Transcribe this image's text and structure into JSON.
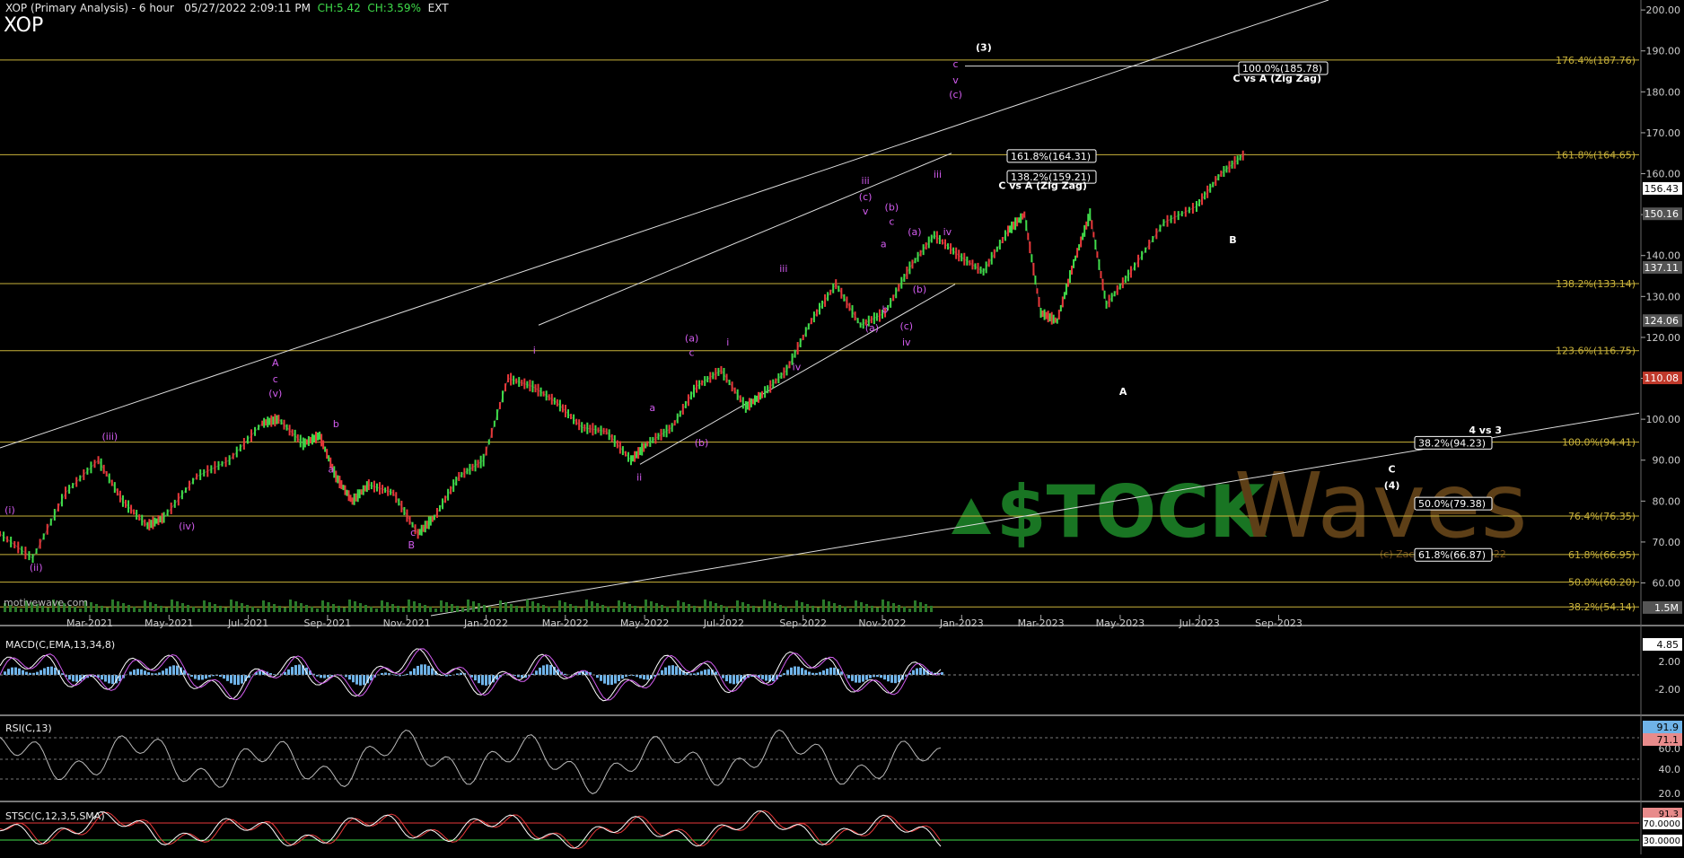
{
  "header": {
    "title": "XOP (Primary Analysis) - 6 hour",
    "datetime": "05/27/2022 2:09:11 PM",
    "ch": "CH:5.42",
    "chpct": "CH:3.59%",
    "ext": "EXT",
    "symbol": "XOP",
    "watermark": "motivewave.com"
  },
  "colors": {
    "fib": "#c9b23a",
    "wave": "#d35cf0",
    "up": "#3fdc4a",
    "down": "#e8383a",
    "white": "#ffffff",
    "logo_green": "#1e8a2a",
    "logo_brown": "#6e4a1c"
  },
  "chart_data": {
    "type": "line",
    "x_ticks": [
      "Mar-2021",
      "May-2021",
      "Jul-2021",
      "Sep-2021",
      "Nov-2021",
      "Jan-2022",
      "Mar-2022",
      "May-2022",
      "Jul-2022",
      "Sep-2022",
      "Nov-2022",
      "Jan-2023",
      "Mar-2023",
      "May-2023",
      "Jul-2023",
      "Sep-2023"
    ],
    "y_ticks": [
      200,
      190,
      180,
      170,
      160,
      150,
      140,
      130,
      120,
      110,
      100,
      90,
      80,
      70,
      60
    ],
    "ylim": [
      52,
      202
    ],
    "price_flags": [
      {
        "label": "156.43",
        "value": 156.4,
        "style": "white"
      },
      {
        "label": "150.16",
        "value": 150.2,
        "style": "gray"
      },
      {
        "label": "137.11",
        "value": 137.1,
        "style": "gray"
      },
      {
        "label": "124.06",
        "value": 124.1,
        "style": "gray"
      },
      {
        "label": "110.08",
        "value": 110.1,
        "style": "red"
      },
      {
        "label": "1.5M",
        "value": 54.0,
        "style": "gray"
      }
    ],
    "price_path": [
      [
        0,
        72
      ],
      [
        0.02,
        66
      ],
      [
        0.04,
        82
      ],
      [
        0.06,
        90
      ],
      [
        0.075,
        80
      ],
      [
        0.09,
        74
      ],
      [
        0.1,
        76
      ],
      [
        0.12,
        86
      ],
      [
        0.14,
        90
      ],
      [
        0.16,
        99
      ],
      [
        0.17,
        100
      ],
      [
        0.185,
        94
      ],
      [
        0.195,
        96
      ],
      [
        0.205,
        86
      ],
      [
        0.215,
        80
      ],
      [
        0.225,
        84
      ],
      [
        0.24,
        82
      ],
      [
        0.255,
        72
      ],
      [
        0.265,
        76
      ],
      [
        0.28,
        86
      ],
      [
        0.295,
        90
      ],
      [
        0.31,
        110
      ],
      [
        0.325,
        108
      ],
      [
        0.34,
        104
      ],
      [
        0.355,
        98
      ],
      [
        0.37,
        97
      ],
      [
        0.385,
        90
      ],
      [
        0.395,
        94
      ],
      [
        0.41,
        98
      ],
      [
        0.425,
        108
      ],
      [
        0.44,
        112
      ],
      [
        0.455,
        103
      ],
      [
        0.465,
        106
      ],
      [
        0.48,
        112
      ],
      [
        0.495,
        124
      ],
      [
        0.51,
        133
      ],
      [
        0.525,
        123
      ],
      [
        0.54,
        126
      ],
      [
        0.555,
        137
      ],
      [
        0.57,
        145
      ],
      [
        0.585,
        140
      ],
      [
        0.6,
        136
      ],
      [
        0.615,
        146
      ],
      [
        0.625,
        150
      ],
      [
        0.635,
        126
      ],
      [
        0.645,
        124
      ],
      [
        0.655,
        138
      ],
      [
        0.665,
        150
      ],
      [
        0.675,
        128
      ],
      [
        0.69,
        136
      ],
      [
        0.71,
        148
      ],
      [
        0.73,
        152
      ],
      [
        0.745,
        160
      ],
      [
        0.76,
        165
      ]
    ],
    "fib_levels": [
      {
        "label": "176.4%(187.76)",
        "value": 187.76
      },
      {
        "label": "161.8%(164.65)",
        "value": 164.65
      },
      {
        "label": "138.2%(133.14)",
        "value": 133.14
      },
      {
        "label": "123.6%(116.75)",
        "value": 116.75
      },
      {
        "label": "100.0%(94.41)",
        "value": 94.41
      },
      {
        "label": "76.4%(76.35)",
        "value": 76.35
      },
      {
        "label": "61.8%(66.95)",
        "value": 66.95
      },
      {
        "label": "50.0%(60.20)",
        "value": 60.2
      },
      {
        "label": "38.2%(54.14)",
        "value": 54.14
      }
    ],
    "target_boxes": [
      {
        "label": "100.0%(185.78)",
        "value": 185.78
      },
      {
        "label": "161.8%(164.31)",
        "value": 164.31
      },
      {
        "label": "138.2%(159.21)",
        "value": 159.21
      },
      {
        "label": "38.2%(94.23)",
        "value": 94.23
      },
      {
        "label": "50.0%(79.38)",
        "value": 79.38
      },
      {
        "label": "61.8%(66.87)",
        "value": 66.87
      }
    ],
    "annotations": [
      {
        "text": "C vs A (Zig Zag)",
        "value": 182.5,
        "xf": 0.76
      },
      {
        "text": "C vs A (Zig Zag)",
        "value": 156.3,
        "xf": 0.617
      },
      {
        "text": "4 vs 3",
        "value": 96.5,
        "xf": 0.887
      },
      {
        "text": "B",
        "value": 143,
        "xf": 0.733
      },
      {
        "text": "A",
        "value": 106,
        "xf": 0.666
      },
      {
        "text": "C",
        "value": 87,
        "xf": 0.83
      },
      {
        "text": "(4)",
        "value": 83,
        "xf": 0.83
      },
      {
        "text": "(3)",
        "value": 190,
        "xf": 0.581
      }
    ],
    "wave_labels": [
      {
        "text": "(i)",
        "value": 77,
        "xf": 0.006
      },
      {
        "text": "(ii)",
        "value": 63,
        "xf": 0.022
      },
      {
        "text": "(iii)",
        "value": 95,
        "xf": 0.067
      },
      {
        "text": "(iv)",
        "value": 73,
        "xf": 0.114
      },
      {
        "text": "A",
        "value": 113,
        "xf": 0.168
      },
      {
        "text": "c",
        "value": 109,
        "xf": 0.168
      },
      {
        "text": "(v)",
        "value": 105.5,
        "xf": 0.168
      },
      {
        "text": "b",
        "value": 98,
        "xf": 0.205
      },
      {
        "text": "a",
        "value": 87,
        "xf": 0.202
      },
      {
        "text": "c",
        "value": 71.5,
        "xf": 0.252
      },
      {
        "text": "B",
        "value": 68.5,
        "xf": 0.251
      },
      {
        "text": "i",
        "value": 116,
        "xf": 0.326
      },
      {
        "text": "ii",
        "value": 85,
        "xf": 0.39
      },
      {
        "text": "(a)",
        "value": 119,
        "xf": 0.422
      },
      {
        "text": "c",
        "value": 115.5,
        "xf": 0.422
      },
      {
        "text": "a",
        "value": 102,
        "xf": 0.398
      },
      {
        "text": "(b)",
        "value": 93.5,
        "xf": 0.428
      },
      {
        "text": "i",
        "value": 118,
        "xf": 0.444
      },
      {
        "text": "iii",
        "value": 136,
        "xf": 0.478
      },
      {
        "text": "iv",
        "value": 112,
        "xf": 0.486
      },
      {
        "text": "iii",
        "value": 157.5,
        "xf": 0.528
      },
      {
        "text": "(c)",
        "value": 153.5,
        "xf": 0.528
      },
      {
        "text": "v",
        "value": 150,
        "xf": 0.528
      },
      {
        "text": "(b)",
        "value": 151,
        "xf": 0.544
      },
      {
        "text": "c",
        "value": 147.5,
        "xf": 0.544
      },
      {
        "text": "a",
        "value": 142,
        "xf": 0.539
      },
      {
        "text": "b",
        "value": 126,
        "xf": 0.54
      },
      {
        "text": "(a)",
        "value": 121.5,
        "xf": 0.532
      },
      {
        "text": "(a)",
        "value": 145,
        "xf": 0.558
      },
      {
        "text": "(c)",
        "value": 122,
        "xf": 0.553
      },
      {
        "text": "iv",
        "value": 118,
        "xf": 0.553
      },
      {
        "text": "(b)",
        "value": 131,
        "xf": 0.561
      },
      {
        "text": "iii",
        "value": 159,
        "xf": 0.572
      },
      {
        "text": "iv",
        "value": 145,
        "xf": 0.578
      },
      {
        "text": "c",
        "value": 186,
        "xf": 0.583
      },
      {
        "text": "v",
        "value": 182,
        "xf": 0.583
      },
      {
        "text": "(c)",
        "value": 178.5,
        "xf": 0.583
      }
    ],
    "macd": {
      "title": "MACD(C,EMA,13,34,8)",
      "ticks": [
        "2.00",
        "-2.00"
      ],
      "flag": "4.85"
    },
    "rsi": {
      "title": "RSI(C,13)",
      "ticks": [
        "60.0",
        "40.0",
        "20.0"
      ],
      "flags": [
        "91.9",
        "71.1"
      ]
    },
    "stoch": {
      "title": "STSC(C,12,3,5,SMA)",
      "flags": [
        "91.3",
        "70.0000",
        "30.0000"
      ]
    }
  },
  "logo": {
    "left": "$TOCK",
    "right": "Waves",
    "copyright": "(c) Zachary Mannes 2022"
  }
}
